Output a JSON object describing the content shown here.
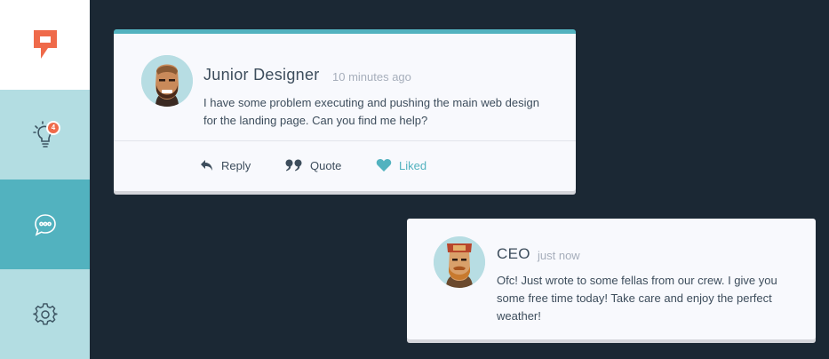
{
  "sidebar": {
    "logo_icon": "brand-logo-icon",
    "items": [
      {
        "name": "ideas",
        "icon": "lightbulb-icon",
        "badge": "4"
      },
      {
        "name": "chat",
        "icon": "chat-bubble-icon",
        "active": true
      },
      {
        "name": "settings",
        "icon": "gear-icon"
      }
    ]
  },
  "colors": {
    "background": "#1b2834",
    "accent": "#52b2bf",
    "sidebar_light": "#b3dde2",
    "badge": "#ef6a4a",
    "brand": "#ef6a4a"
  },
  "comments": [
    {
      "author": "Junior Designer",
      "time": "10 minutes ago",
      "message": "I have some problem executing and pushing the main web design for the landing page. Can you find me help?",
      "actions": {
        "reply": "Reply",
        "quote": "Quote",
        "like": "Liked"
      }
    },
    {
      "author": "CEO",
      "time": "just now",
      "message": "Ofc! Just wrote to some fellas from our crew. I give you some free time today! Take care and enjoy the perfect weather!"
    }
  ]
}
